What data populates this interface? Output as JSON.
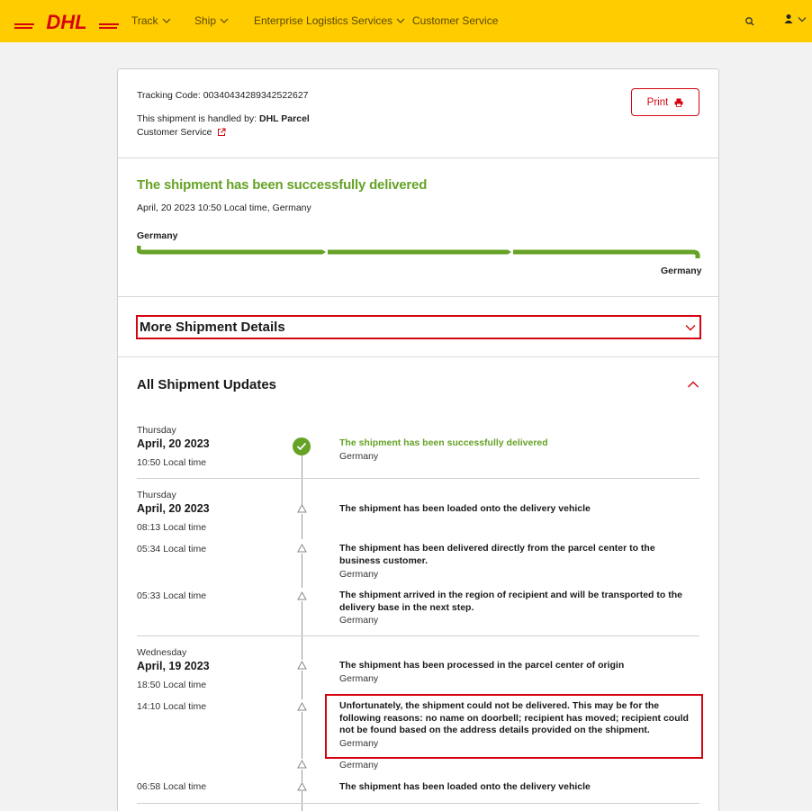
{
  "nav": {
    "brand": "DHL",
    "items": [
      {
        "label": "Track",
        "has_dropdown": true
      },
      {
        "label": "Ship",
        "has_dropdown": true
      },
      {
        "label": "Enterprise Logistics Services",
        "has_dropdown": true
      },
      {
        "label": "Customer Service",
        "has_dropdown": false
      }
    ]
  },
  "info": {
    "tracking_label": "Tracking Code: 00340434289342522627",
    "handled_label": "This shipment is handled by: ",
    "handler": "DHL Parcel",
    "customer_service": "Customer Service",
    "print_label": "Print"
  },
  "status": {
    "title": "The shipment has been successfully delivered",
    "datetime": "April, 20 2023 10:50 Local time, Germany",
    "origin": "Germany",
    "destination": "Germany"
  },
  "details": {
    "more_label": "More Shipment Details",
    "updates_title": "All Shipment Updates"
  },
  "events": [
    {
      "day": "Thursday",
      "date": "April, 20 2023",
      "time": "10:50 Local time",
      "text": "The shipment has been successfully delivered",
      "location": "Germany"
    },
    {
      "day": "Thursday",
      "date": "April, 20 2023",
      "time": "08:13 Local time",
      "text": "The shipment has been loaded onto the delivery vehicle",
      "location": ""
    },
    {
      "time": "05:34 Local time",
      "text": "The shipment has been delivered directly from the parcel center to the business customer.",
      "location": "Germany"
    },
    {
      "time": "05:33 Local time",
      "text": "The shipment arrived in the region of recipient and will be transported to the delivery base in the next step.",
      "location": "Germany"
    },
    {
      "day": "Wednesday",
      "date": "April, 19 2023",
      "time": "18:50 Local time",
      "text": "The shipment has been processed in the parcel center of origin",
      "location": "Germany"
    },
    {
      "time": "14:10 Local time",
      "text": "Unfortunately, the shipment could not be delivered. This may be for the following reasons: no name on doorbell; recipient has moved; recipient could not be found based on the address details provided on the shipment.",
      "location": "Germany"
    },
    {
      "time": "",
      "text": "",
      "location": "Germany"
    },
    {
      "time": "06:58 Local time",
      "text": "The shipment has been loaded onto the delivery vehicle",
      "location": ""
    }
  ],
  "colors": {
    "brand_yellow": "#ffcc00",
    "brand_red": "#d40511",
    "success_green": "#66a226"
  },
  "icons": [
    "dhl-logo",
    "chevron-down-icon",
    "search-icon",
    "user-icon",
    "external-link-icon",
    "printer-icon",
    "check-icon",
    "triangle-icon",
    "chevron-up-icon"
  ]
}
